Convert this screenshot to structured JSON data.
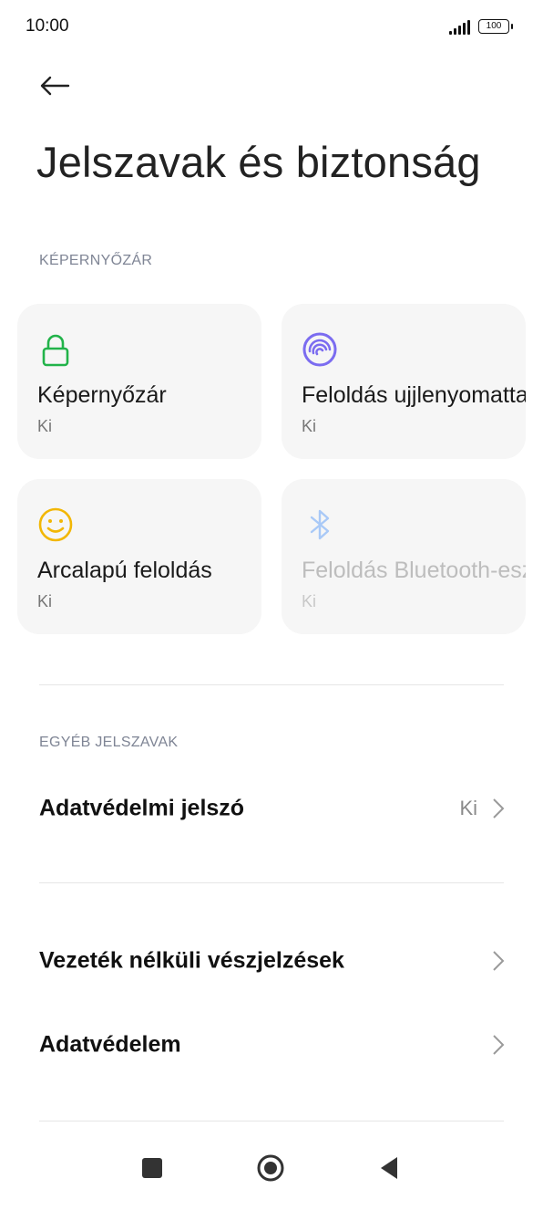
{
  "status_bar": {
    "time": "10:00",
    "battery": "100"
  },
  "header": {
    "title": "Jelszavak és biztonság"
  },
  "screen_lock_section": {
    "header": "KÉPERNYŐZÁR",
    "cards": [
      {
        "title": "Képernyőzár",
        "status": "Ki",
        "icon": "lock-icon",
        "color": "#22b34a"
      },
      {
        "title": "Feloldás ujjlenyomattal",
        "status": "Ki",
        "icon": "fingerprint-icon",
        "color": "#7b6cf0"
      },
      {
        "title": "Arcalapú feloldás",
        "status": "Ki",
        "icon": "face-icon",
        "color": "#f2b705"
      },
      {
        "title": "Feloldás Bluetooth-eszközzel",
        "status": "Ki",
        "icon": "bluetooth-icon",
        "color": "#a9c9f7"
      }
    ]
  },
  "other_passwords_section": {
    "header": "EGYÉB JELSZAVAK",
    "privacy_password": {
      "label": "Adatvédelmi jelszó",
      "value": "Ki"
    }
  },
  "menu": {
    "wireless_alerts": "Vezeték nélküli vészjelzések",
    "privacy": "Adatvédelem"
  },
  "nav": {
    "recents": "recents-icon",
    "home": "home-icon",
    "back": "back-icon"
  }
}
